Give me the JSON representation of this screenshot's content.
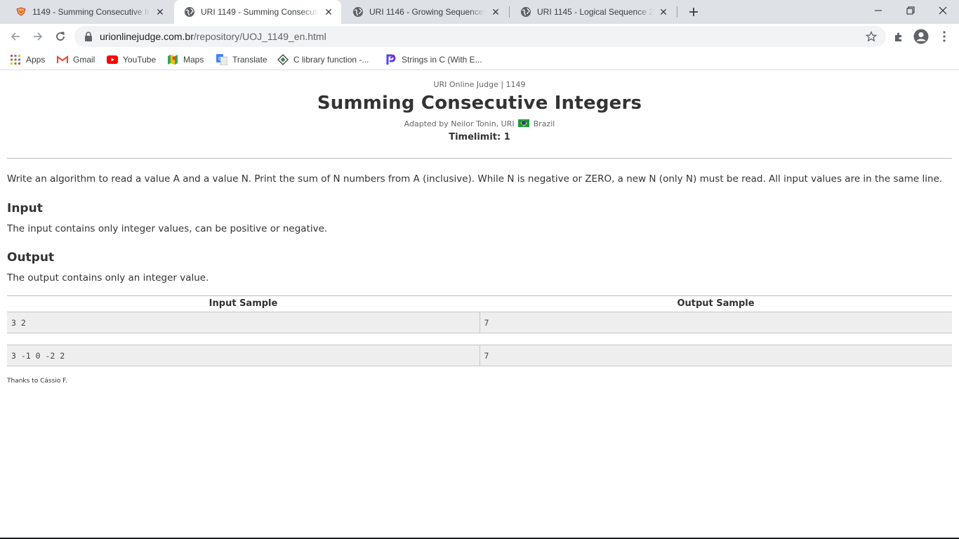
{
  "browser": {
    "tabs": [
      {
        "title": "1149 - Summing Consecutive Integers",
        "icon": "uri-judge-icon",
        "active": false
      },
      {
        "title": "URI 1149 - Summing Consecutive Integers",
        "icon": "globe-icon",
        "active": true
      },
      {
        "title": "URI 1146 - Growing Sequences",
        "icon": "globe-icon",
        "active": false
      },
      {
        "title": "URI 1145 - Logical Sequence 2",
        "icon": "globe-icon",
        "active": false
      }
    ],
    "url_host": "urionlinejudge.com.br",
    "url_path": "/repository/UOJ_1149_en.html",
    "bookmarks": [
      {
        "label": "Apps",
        "icon": "apps-grid-icon"
      },
      {
        "label": "Gmail",
        "icon": "gmail-icon"
      },
      {
        "label": "YouTube",
        "icon": "youtube-icon"
      },
      {
        "label": "Maps",
        "icon": "maps-icon"
      },
      {
        "label": "Translate",
        "icon": "translate-icon"
      },
      {
        "label": "C library function -...",
        "icon": "c-library-icon"
      },
      {
        "label": "Strings in C (With E...",
        "icon": "programiz-icon"
      }
    ]
  },
  "problem": {
    "source": "URI Online Judge | 1149",
    "title": "Summing Consecutive Integers",
    "adapted_by": "Adapted by Neilor Tonin, URI",
    "country": "Brazil",
    "timelimit": "Timelimit: 1",
    "description": "Write an algorithm to read a value A and a value N. Print the sum of N numbers from A (inclusive). While N is negative or ZERO, a new N (only N) must be read. All input values are in the same line.",
    "input_heading": "Input",
    "input_text": "The input contains only integer values, can be positive or negative.",
    "output_heading": "Output",
    "output_text": "The output contains only an integer value.",
    "samples_header": {
      "input": "Input Sample",
      "output": "Output Sample"
    },
    "samples": [
      {
        "input": "3 2",
        "output": "7"
      },
      {
        "input": "3 -1 0 -2 2",
        "output": "7"
      }
    ],
    "thanks": "Thanks to Cássio F."
  }
}
